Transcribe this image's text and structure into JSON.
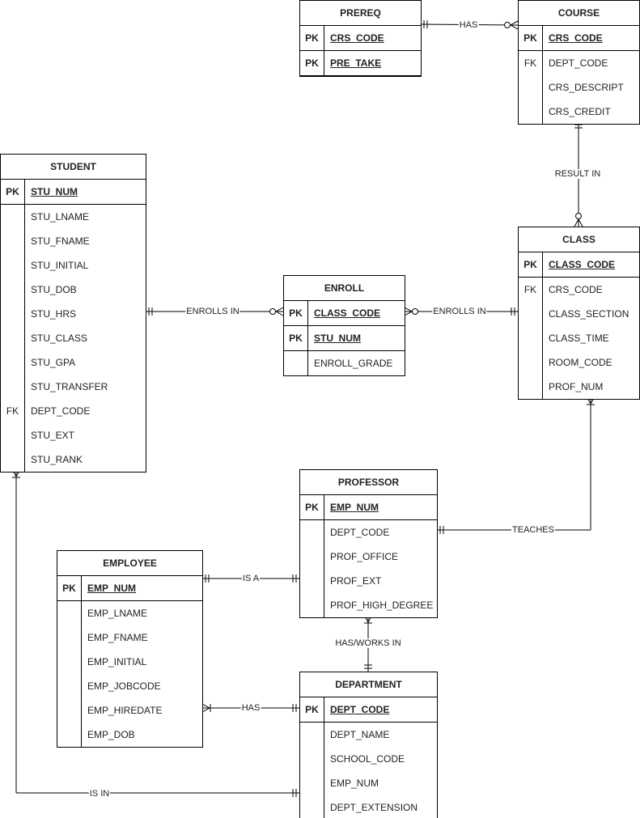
{
  "entities": [
    {
      "id": "prereq",
      "title": "PREREQ",
      "rows": [
        {
          "k": "PK",
          "n": "CRS_CODE",
          "pk": true
        },
        {
          "k": "PK",
          "n": "PRE_TAKE",
          "pk": true
        }
      ]
    },
    {
      "id": "course",
      "title": "COURSE",
      "rows": [
        {
          "k": "PK",
          "n": "CRS_CODE",
          "pk": true
        },
        {
          "k": "FK",
          "n": "DEPT_CODE"
        },
        {
          "k": "",
          "n": "CRS_DESCRIPT"
        },
        {
          "k": "",
          "n": "CRS_CREDIT"
        }
      ]
    },
    {
      "id": "student",
      "title": "STUDENT",
      "rows": [
        {
          "k": "PK",
          "n": "STU_NUM",
          "pk": true
        },
        {
          "k": "",
          "n": "STU_LNAME"
        },
        {
          "k": "",
          "n": "STU_FNAME"
        },
        {
          "k": "",
          "n": "STU_INITIAL"
        },
        {
          "k": "",
          "n": "STU_DOB"
        },
        {
          "k": "",
          "n": "STU_HRS"
        },
        {
          "k": "",
          "n": "STU_CLASS"
        },
        {
          "k": "",
          "n": "STU_GPA"
        },
        {
          "k": "",
          "n": "STU_TRANSFER"
        },
        {
          "k": "FK",
          "n": "DEPT_CODE"
        },
        {
          "k": "",
          "n": "STU_EXT"
        },
        {
          "k": "",
          "n": "STU_RANK"
        }
      ]
    },
    {
      "id": "enroll",
      "title": "ENROLL",
      "rows": [
        {
          "k": "PK",
          "n": "CLASS_CODE",
          "pk": true
        },
        {
          "k": "PK",
          "n": "STU_NUM",
          "pk": true
        },
        {
          "k": "",
          "n": "ENROLL_GRADE"
        }
      ]
    },
    {
      "id": "class",
      "title": "CLASS",
      "rows": [
        {
          "k": "PK",
          "n": "CLASS_CODE",
          "pk": true
        },
        {
          "k": "FK",
          "n": "CRS_CODE"
        },
        {
          "k": "",
          "n": "CLASS_SECTION"
        },
        {
          "k": "",
          "n": "CLASS_TIME"
        },
        {
          "k": "",
          "n": "ROOM_CODE"
        },
        {
          "k": "",
          "n": "PROF_NUM"
        }
      ]
    },
    {
      "id": "professor",
      "title": "PROFESSOR",
      "rows": [
        {
          "k": "PK",
          "n": "EMP_NUM",
          "pk": true
        },
        {
          "k": "",
          "n": "DEPT_CODE"
        },
        {
          "k": "",
          "n": "PROF_OFFICE"
        },
        {
          "k": "",
          "n": "PROF_EXT"
        },
        {
          "k": "",
          "n": "PROF_HIGH_DEGREE"
        }
      ]
    },
    {
      "id": "employee",
      "title": "EMPLOYEE",
      "rows": [
        {
          "k": "PK",
          "n": "EMP_NUM",
          "pk": true
        },
        {
          "k": "",
          "n": "EMP_LNAME"
        },
        {
          "k": "",
          "n": "EMP_FNAME"
        },
        {
          "k": "",
          "n": "EMP_INITIAL"
        },
        {
          "k": "",
          "n": "EMP_JOBCODE"
        },
        {
          "k": "",
          "n": "EMP_HIREDATE"
        },
        {
          "k": "",
          "n": "EMP_DOB"
        }
      ]
    },
    {
      "id": "department",
      "title": "DEPARTMENT",
      "rows": [
        {
          "k": "PK",
          "n": "DEPT_CODE",
          "pk": true
        },
        {
          "k": "",
          "n": "DEPT_NAME"
        },
        {
          "k": "",
          "n": "SCHOOL_CODE"
        },
        {
          "k": "",
          "n": "EMP_NUM"
        },
        {
          "k": "",
          "n": "DEPT_EXTENSION"
        }
      ]
    }
  ],
  "relationships": [
    {
      "label": "HAS",
      "from": "prereq",
      "to": "course",
      "from_card": "one-and-only-one",
      "to_card": "zero-or-many"
    },
    {
      "label": "RESULT IN",
      "from": "course",
      "to": "class",
      "from_card": "one-and-only-one",
      "to_card": "zero-or-many"
    },
    {
      "label": "ENROLLS IN",
      "from": "student",
      "to": "enroll",
      "from_card": "one-and-only-one",
      "to_card": "zero-or-many"
    },
    {
      "label": "ENROLLS IN",
      "from": "enroll",
      "to": "class",
      "from_card": "zero-or-many",
      "to_card": "one-and-only-one"
    },
    {
      "label": "TEACHES",
      "from": "class",
      "to": "professor",
      "from_card": "one-or-many",
      "to_card": "one-and-only-one"
    },
    {
      "label": "IS A",
      "from": "employee",
      "to": "professor",
      "from_card": "one-and-only-one",
      "to_card": "one-and-only-one"
    },
    {
      "label": "HAS/WORKS IN",
      "from": "professor",
      "to": "department",
      "from_card": "one-or-many",
      "to_card": "one-and-only-one"
    },
    {
      "label": "HAS",
      "from": "employee",
      "to": "department",
      "from_card": "one-or-many",
      "to_card": "one-and-only-one"
    },
    {
      "label": "IS IN",
      "from": "student",
      "to": "department",
      "from_card": "one-or-many",
      "to_card": "one-and-only-one"
    }
  ]
}
